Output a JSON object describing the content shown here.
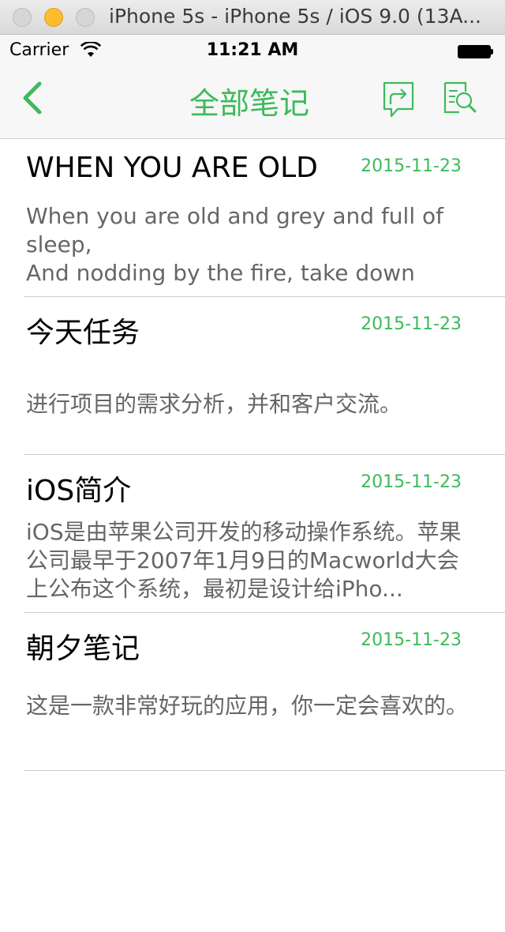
{
  "window": {
    "title": "iPhone 5s - iPhone 5s / iOS 9.0 (13A..."
  },
  "status_bar": {
    "carrier": "Carrier",
    "time": "11:21 AM"
  },
  "nav": {
    "title": "全部笔记",
    "back_icon": "chevron-left-icon",
    "share_icon": "share-icon",
    "search_icon": "search-document-icon",
    "accent_color": "#3dba5b"
  },
  "notes": [
    {
      "title": "WHEN YOU ARE OLD",
      "date": "2015-11-23",
      "body": "When you are old and grey and full of sleep,\nAnd nodding by the fire, take down this..."
    },
    {
      "title": "今天任务",
      "date": "2015-11-23",
      "body": "进行项目的需求分析，并和客户交流。"
    },
    {
      "title": "iOS简介",
      "date": "2015-11-23",
      "body": "iOS是由苹果公司开发的移动操作系统。苹果公司最早于2007年1月9日的Macworld大会上公布这个系统，最初是设计给iPho..."
    },
    {
      "title": "朝夕笔记",
      "date": "2015-11-23",
      "body": "这是一款非常好玩的应用，你一定会喜欢的。"
    }
  ]
}
